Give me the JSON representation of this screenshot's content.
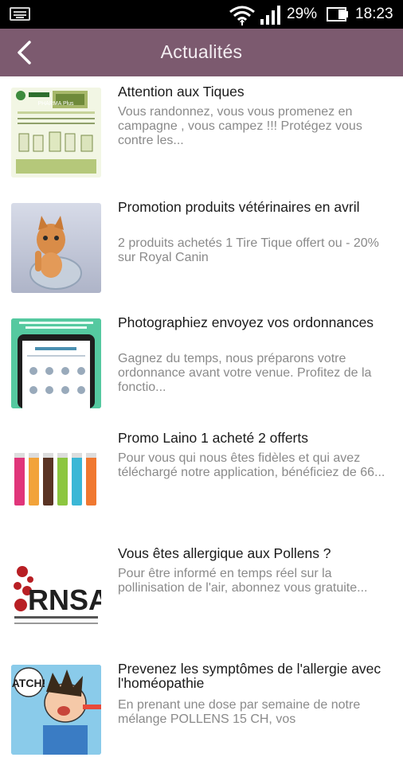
{
  "status_bar": {
    "battery_percent": "29%",
    "time": "18:23",
    "icons": [
      "keyboard-icon",
      "wifi-icon",
      "signal-icon",
      "battery-icon"
    ]
  },
  "app_bar": {
    "title": "Actualités",
    "background_color": "#7c5a6f",
    "back_icon": "chevron-left-icon"
  },
  "news": [
    {
      "title": "Attention aux Tiques",
      "excerpt": "Vous randonnez, vous vous promenez en campagne , vous campez !!! Protégez vous contre les...",
      "thumb_text": "PHARMA Plus"
    },
    {
      "title": "Promotion produits vétérinaires en avril",
      "excerpt": "2 produits achetés 1 Tire Tique offert ou - 20% sur Royal Canin"
    },
    {
      "title": "Photographiez envoyez vos ordonnances",
      "excerpt": "Gagnez du temps, nous préparons votre ordonnance avant votre venue. Profitez de la fonctio..."
    },
    {
      "title": "Promo Laino 1 acheté 2 offerts",
      "excerpt": "Pour vous qui nous êtes fidèles et qui avez téléchargé notre application, bénéficiez de 66..."
    },
    {
      "title": "Vous êtes allergique aux Pollens ?",
      "excerpt": "Pour être informé en temps réel sur la pollinisation de l'air, abonnez vous gratuite...",
      "thumb_text": "RNSA"
    },
    {
      "title": "Prevenez les symptômes de l'allergie avec l'homéopathie",
      "excerpt": "En prenant une dose par semaine de notre mélange POLLENS 15 CH, vos",
      "thumb_text": "ATCH!"
    }
  ]
}
